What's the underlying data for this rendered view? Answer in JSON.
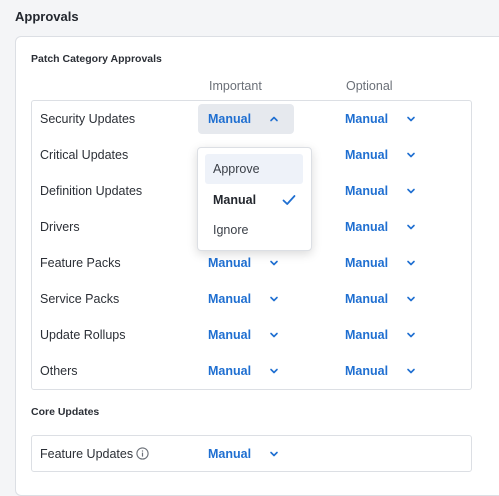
{
  "page": {
    "title": "Approvals"
  },
  "patch_category": {
    "heading": "Patch Category Approvals",
    "columns": {
      "important": "Important",
      "optional": "Optional"
    },
    "rows": [
      {
        "label": "Security Updates",
        "important": "Manual",
        "optional": "Manual"
      },
      {
        "label": "Critical Updates",
        "important": "",
        "optional": "Manual"
      },
      {
        "label": "Definition Updates",
        "important": "",
        "optional": "Manual"
      },
      {
        "label": "Drivers",
        "important": "",
        "optional": "Manual"
      },
      {
        "label": "Feature Packs",
        "important": "Manual",
        "optional": "Manual"
      },
      {
        "label": "Service Packs",
        "important": "Manual",
        "optional": "Manual"
      },
      {
        "label": "Update Rollups",
        "important": "Manual",
        "optional": "Manual"
      },
      {
        "label": "Others",
        "important": "Manual",
        "optional": "Manual"
      }
    ]
  },
  "core_updates": {
    "heading": "Core Updates",
    "rows": [
      {
        "label": "Feature Updates",
        "important": "Manual"
      }
    ]
  },
  "dropdown": {
    "open_row": "Security Updates",
    "options": [
      "Approve",
      "Manual",
      "Ignore"
    ],
    "selected": "Manual",
    "hovered": "Approve"
  },
  "colors": {
    "accent": "#1f6fd1",
    "text": "#2b2f36",
    "muted": "#6b7078",
    "border": "#dcdfe4"
  },
  "icons": {
    "chevron": "chevron-down-icon",
    "chevron_open": "chevron-up-icon",
    "info": "info-icon",
    "check": "check-icon"
  }
}
